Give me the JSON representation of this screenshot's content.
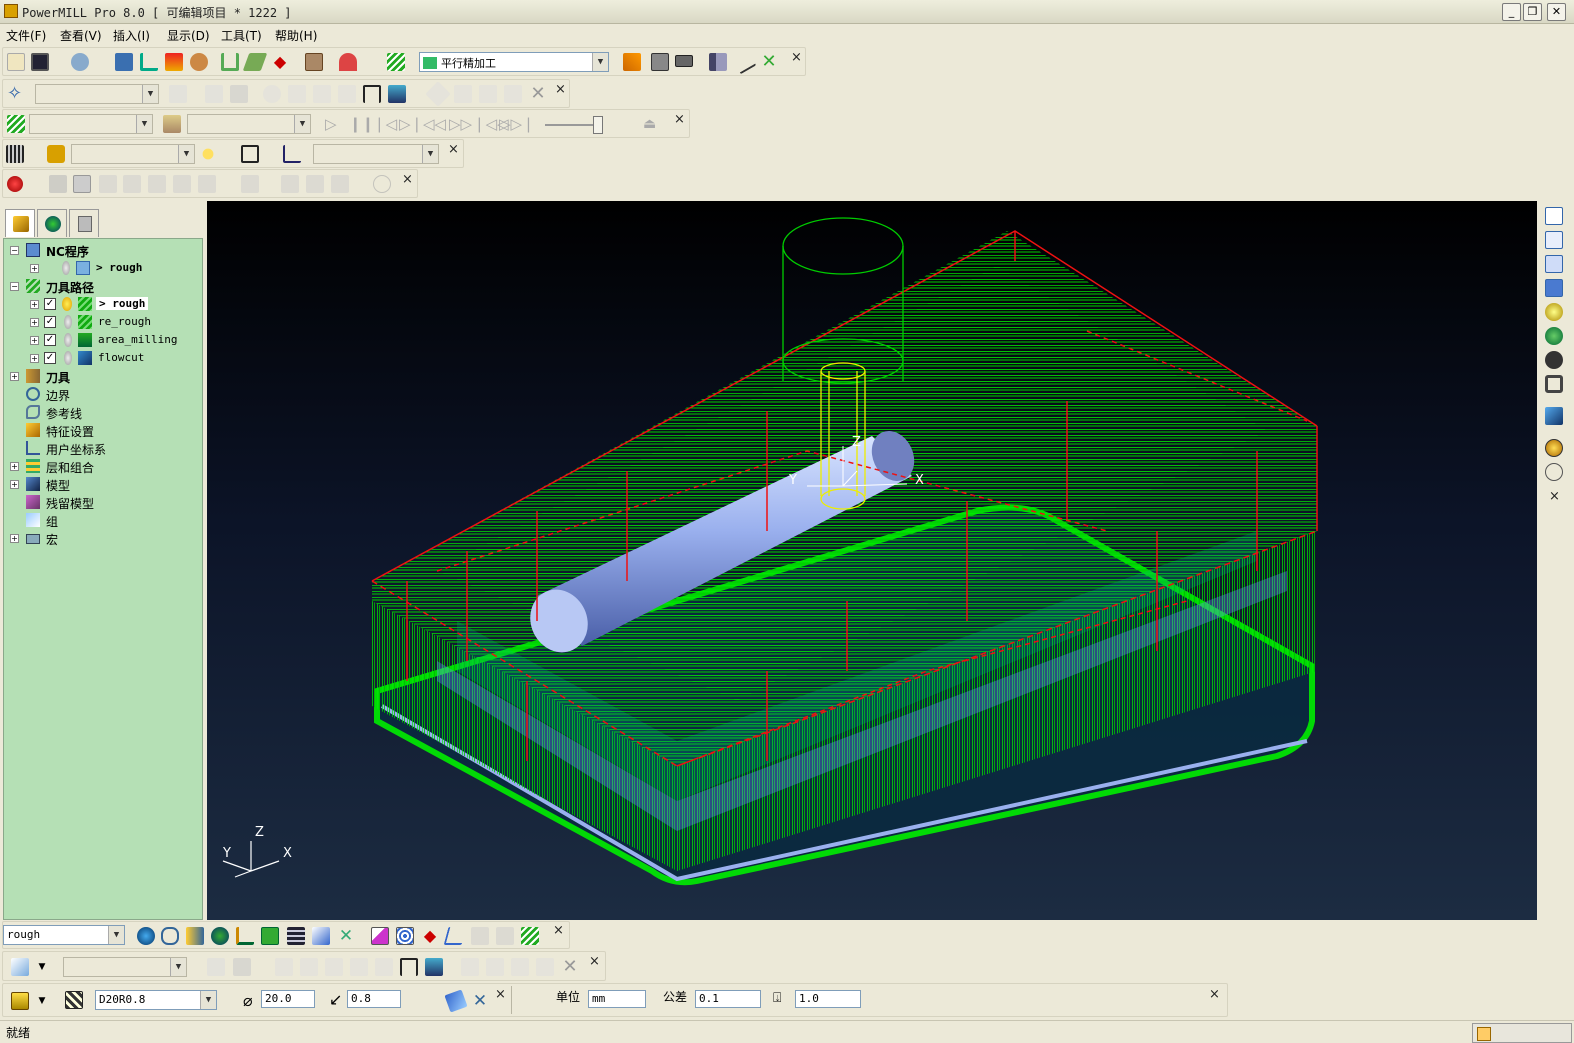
{
  "app": {
    "title": "PowerMILL Pro 8.0     [ 可编辑项目 * 1222 ]"
  },
  "window_buttons": {
    "minimize": "_",
    "restore": "❐",
    "close": "✕"
  },
  "menu": [
    "文件(F)",
    "查看(V)",
    "插入(I)",
    "显示(D)",
    "工具(T)",
    "帮助(H)"
  ],
  "toolbars": {
    "strategy_select": "平行精加工",
    "close": "×"
  },
  "explorer": {
    "items": [
      {
        "label": "NC程序",
        "level": 0,
        "expand": "−"
      },
      {
        "label": "> rough",
        "level": 1,
        "expand": "+"
      },
      {
        "label": "刀具路径",
        "level": 0,
        "expand": "−"
      },
      {
        "label": "> rough",
        "level": 1,
        "expand": "+",
        "checked": "✓"
      },
      {
        "label": "re_rough",
        "level": 1,
        "expand": "+",
        "checked": "✓"
      },
      {
        "label": "area_milling",
        "level": 1,
        "expand": "+",
        "checked": "✓"
      },
      {
        "label": "flowcut",
        "level": 1,
        "expand": "+",
        "checked": "✓"
      },
      {
        "label": "刀具",
        "level": 0,
        "expand": "+"
      },
      {
        "label": "边界",
        "level": 0
      },
      {
        "label": "参考线",
        "level": 0
      },
      {
        "label": "特征设置",
        "level": 0
      },
      {
        "label": "用户坐标系",
        "level": 0
      },
      {
        "label": "层和组合",
        "level": 0,
        "expand": "+"
      },
      {
        "label": "模型",
        "level": 0,
        "expand": "+"
      },
      {
        "label": "残留模型",
        "level": 0
      },
      {
        "label": "组",
        "level": 0
      },
      {
        "label": "宏",
        "level": 0,
        "expand": "+"
      }
    ]
  },
  "viewport": {
    "axis": {
      "x": "X",
      "y": "Y",
      "z": "Z"
    },
    "tool_axis": {
      "x": "X",
      "y": "Y",
      "z": "Z"
    }
  },
  "bottom": {
    "toolpath_select": "rough",
    "tool_select": "D20R0.8",
    "diameter": "20.0",
    "tip_radius": "0.8",
    "unit_label": "单位",
    "unit_value": "mm",
    "tolerance_label": "公差",
    "tolerance_value": "0.1",
    "stepover_value": "1.0"
  },
  "status": {
    "text": "就绪"
  },
  "colors": {
    "toolpath": "#00ee00",
    "rapid": "#ee1111",
    "stock": "#9ab0ee",
    "tree_bg": "#b5e0b5"
  }
}
